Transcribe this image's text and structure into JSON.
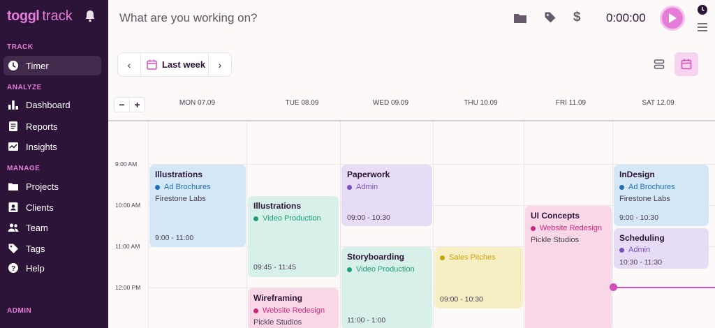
{
  "sidebar": {
    "brand": "toggl",
    "product": "track",
    "sections": {
      "track": "TRACK",
      "analyze": "ANALYZE",
      "manage": "MANAGE",
      "admin": "ADMIN"
    },
    "items": [
      {
        "label": "Timer",
        "icon": "clock-icon",
        "active": true
      },
      {
        "label": "Dashboard",
        "icon": "bar-chart-icon"
      },
      {
        "label": "Reports",
        "icon": "document-icon"
      },
      {
        "label": "Insights",
        "icon": "insights-icon"
      },
      {
        "label": "Projects",
        "icon": "folder-icon"
      },
      {
        "label": "Clients",
        "icon": "client-icon"
      },
      {
        "label": "Team",
        "icon": "team-icon"
      },
      {
        "label": "Tags",
        "icon": "tag-icon"
      },
      {
        "label": "Help",
        "icon": "help-icon"
      }
    ]
  },
  "topbar": {
    "description_placeholder": "What are you working on?",
    "timer": "0:00:00"
  },
  "toolbar": {
    "week_label": "Last week"
  },
  "calendar": {
    "days": [
      "MON 07.09",
      "TUE 08.09",
      "WED 09.09",
      "THU 10.09",
      "FRI 11.09",
      "SAT 12.09"
    ],
    "hours": [
      "9:00 AM",
      "10:00 AM",
      "11:00 AM",
      "12:00 PM"
    ],
    "events": [
      {
        "title": "Illustrations",
        "project": "Ad Brochures",
        "client": "Firestone Labs",
        "time": "9:00 - 11:00"
      },
      {
        "title": "Illustrations",
        "project": "Video Production",
        "client": "",
        "time": "09:45 - 11:45"
      },
      {
        "title": "Wireframing",
        "project": "Website Redesign",
        "client": "Pickle Studios",
        "time": ""
      },
      {
        "title": "Paperwork",
        "project": "Admin",
        "client": "",
        "time": "09:00 - 10:30"
      },
      {
        "title": "Storyboarding",
        "project": "Video Production",
        "client": "",
        "time": "11:00 - 1:00"
      },
      {
        "title": "",
        "project": "Sales Pitches",
        "client": "",
        "time": "09:00 - 10:30"
      },
      {
        "title": "UI Concepts",
        "project": "Website Redesign",
        "client": "Pickle Studios",
        "time": ""
      },
      {
        "title": "InDesign",
        "project": "Ad Brochures",
        "client": "Firestone Labs",
        "time": "9:00 - 10:30"
      },
      {
        "title": "Scheduling",
        "project": "Admin",
        "client": "",
        "time": "10:30 - 11:30"
      }
    ]
  },
  "colors": {
    "sidebar_bg": "#2c1338",
    "accent": "#e57cd8",
    "ad_brochures": "#1e6fb8",
    "video_production": "#1b9e77",
    "website_redesign": "#d0277b",
    "admin": "#7b4fc4",
    "sales_pitches": "#c9a20f"
  }
}
